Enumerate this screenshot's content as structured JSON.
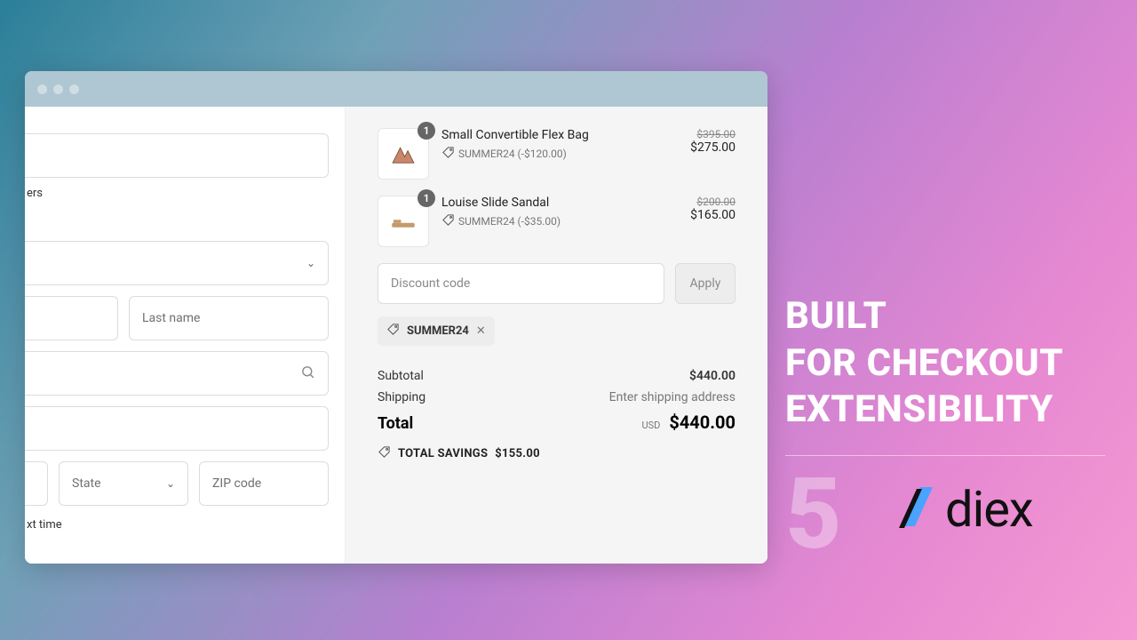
{
  "form": {
    "placeholders": {
      "last_name": "Last name",
      "state": "State",
      "zip": "ZIP code"
    },
    "text_fragments": {
      "ers": "ers",
      "ct_time": "xt time"
    }
  },
  "cart": {
    "items": [
      {
        "qty": "1",
        "title": "Small Convertible Flex Bag",
        "discount_label": "SUMMER24 (-$120.00)",
        "compare_at": "$395.00",
        "price": "$275.00"
      },
      {
        "qty": "1",
        "title": "Louise Slide Sandal",
        "discount_label": "SUMMER24 (-$35.00)",
        "compare_at": "$200.00",
        "price": "$165.00"
      }
    ],
    "discount_placeholder": "Discount code",
    "apply_label": "Apply",
    "applied_code": "SUMMER24",
    "subtotal_label": "Subtotal",
    "subtotal_value": "$440.00",
    "shipping_label": "Shipping",
    "shipping_value": "Enter shipping address",
    "total_label": "Total",
    "total_currency": "USD",
    "total_value": "$440.00",
    "savings_label": "TOTAL SAVINGS",
    "savings_value": "$155.00"
  },
  "marketing": {
    "line1": "BUILT",
    "line2": "FOR CHECKOUT",
    "line3": "EXTENSIBILITY",
    "step": "5",
    "brand": "diex"
  }
}
